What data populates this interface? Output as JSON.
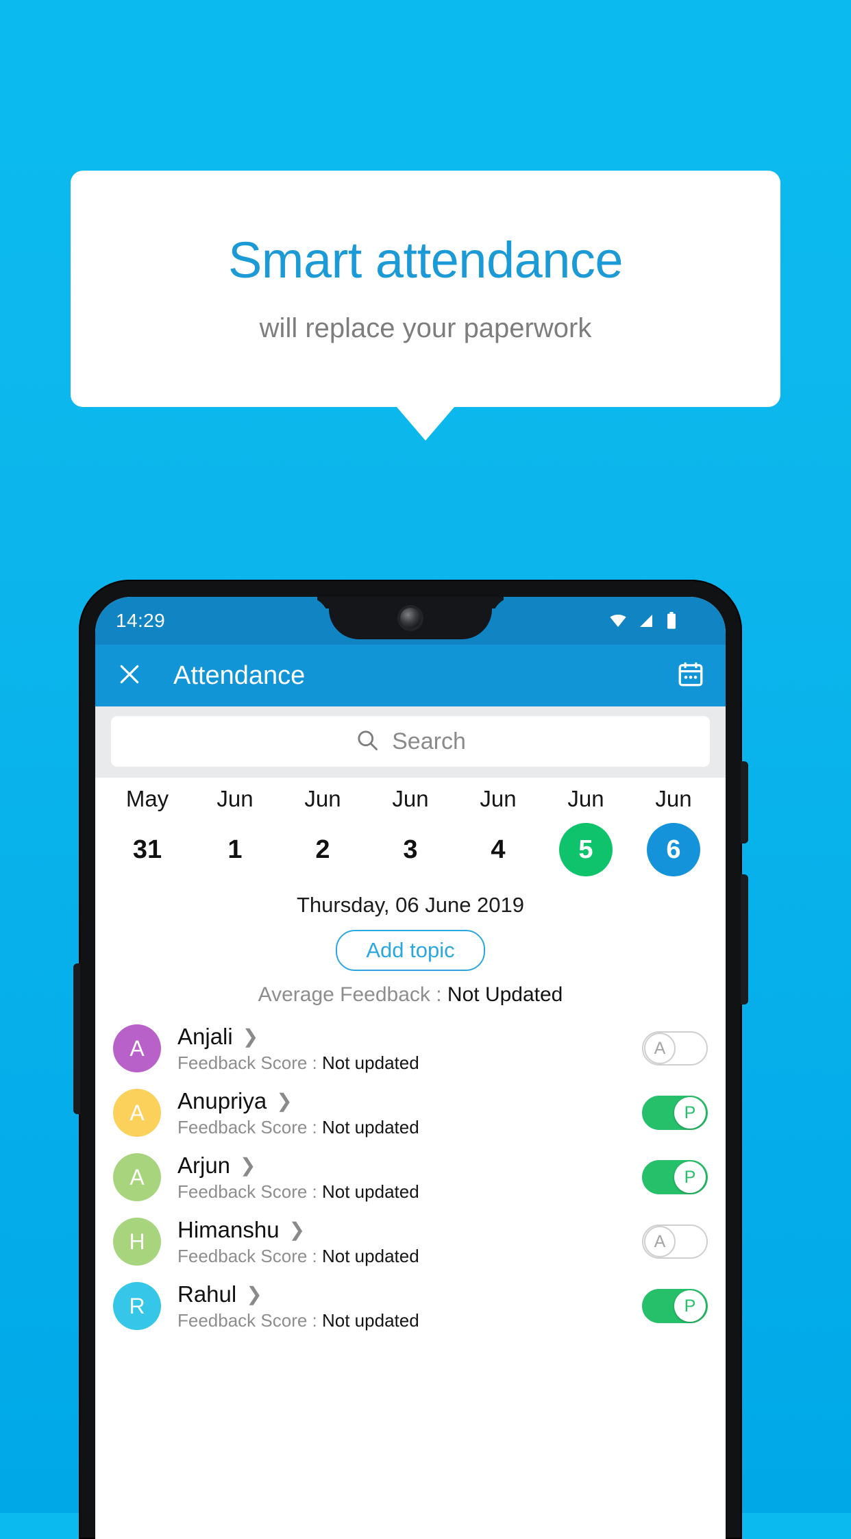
{
  "promo": {
    "title": "Smart attendance",
    "subtitle": "will replace your paperwork",
    "title_color": "#1b9ad6",
    "subtitle_color": "#7d7d7d",
    "background_color": "#0bbbef"
  },
  "status_bar": {
    "time": "14:29",
    "icons": [
      "wifi-icon",
      "signal-icon",
      "battery-icon"
    ]
  },
  "app_bar": {
    "close_label": "✕",
    "title": "Attendance",
    "calendar_icon": "calendar-icon",
    "background_color": "#1295d6"
  },
  "search": {
    "placeholder": "Search",
    "icon": "search-icon"
  },
  "date_strip": [
    {
      "month": "May",
      "day": "31",
      "state": "normal"
    },
    {
      "month": "Jun",
      "day": "1",
      "state": "normal"
    },
    {
      "month": "Jun",
      "day": "2",
      "state": "normal"
    },
    {
      "month": "Jun",
      "day": "3",
      "state": "normal"
    },
    {
      "month": "Jun",
      "day": "4",
      "state": "normal"
    },
    {
      "month": "Jun",
      "day": "5",
      "state": "green"
    },
    {
      "month": "Jun",
      "day": "6",
      "state": "blue"
    }
  ],
  "selected_day_label": "Thursday, 06 June 2019",
  "add_topic_label": "Add topic",
  "average_feedback": {
    "label": "Average Feedback : ",
    "value": "Not Updated"
  },
  "feedback_score_label": "Feedback Score : ",
  "students": [
    {
      "name": "Anjali",
      "initial": "A",
      "avatar_color": "#b861c9",
      "score": "Not updated",
      "attendance": "A",
      "present": false
    },
    {
      "name": "Anupriya",
      "initial": "A",
      "avatar_color": "#fbd05b",
      "score": "Not updated",
      "attendance": "P",
      "present": true
    },
    {
      "name": "Arjun",
      "initial": "A",
      "avatar_color": "#a8d47e",
      "score": "Not updated",
      "attendance": "P",
      "present": true
    },
    {
      "name": "Himanshu",
      "initial": "H",
      "avatar_color": "#a8d47e",
      "score": "Not updated",
      "attendance": "A",
      "present": false
    },
    {
      "name": "Rahul",
      "initial": "R",
      "avatar_color": "#35c6e8",
      "score": "Not updated",
      "attendance": "P",
      "present": true
    }
  ],
  "colors": {
    "accent_blue": "#1492da",
    "present_green": "#26c06a",
    "selected_green": "#0ec36c"
  }
}
